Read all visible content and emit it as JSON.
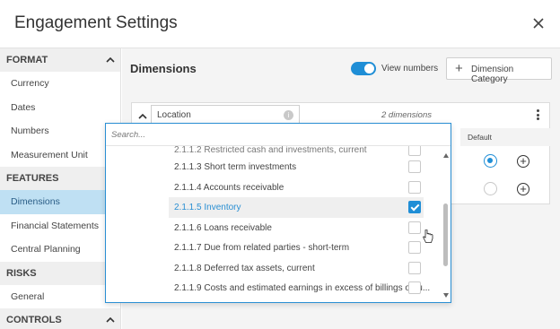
{
  "window": {
    "title": "Engagement Settings"
  },
  "sidebar": {
    "sections": [
      {
        "label": "FORMAT",
        "items": [
          "Currency",
          "Dates",
          "Numbers",
          "Measurement Unit"
        ]
      },
      {
        "label": "FEATURES",
        "items": [
          "Dimensions",
          "Financial Statements",
          "Central Planning"
        ]
      },
      {
        "label": "RISKS",
        "items": [
          "General"
        ]
      },
      {
        "label": "CONTROLS",
        "items": []
      }
    ],
    "active_item": "Dimensions"
  },
  "main": {
    "title": "Dimensions",
    "view_numbers_label": "View numbers",
    "view_numbers_on": true,
    "dimension_category_label": "Dimension Category",
    "card": {
      "field_value": "Location",
      "count_label": "2 dimensions",
      "default_header": "Default",
      "default_selected_row": 0
    }
  },
  "dropdown": {
    "search_placeholder": "Search...",
    "partial_item": "2.1.1.2 Restricted cash and investments, current",
    "items": [
      {
        "label": "2.1.1.3 Short term investments",
        "checked": false
      },
      {
        "label": "2.1.1.4 Accounts receivable",
        "checked": false
      },
      {
        "label": "2.1.1.5 Inventory",
        "checked": true
      },
      {
        "label": "2.1.1.6 Loans receivable",
        "checked": false
      },
      {
        "label": "2.1.1.7 Due from related parties - short-term",
        "checked": false
      },
      {
        "label": "2.1.1.8 Deferred tax assets, current",
        "checked": false
      },
      {
        "label": "2.1.1.9 Costs and estimated earnings in excess of billings on u...",
        "checked": false
      }
    ]
  },
  "colors": {
    "accent": "#1f8ed6",
    "active_bg": "#bfe0f3",
    "section_bg": "#efefef"
  },
  "icons": {
    "close": "close-icon",
    "collapse": "chevron-up-icon",
    "add": "plus-icon",
    "menu": "kebab-menu-icon",
    "info": "info-icon",
    "pointer": "hand-cursor-icon"
  }
}
